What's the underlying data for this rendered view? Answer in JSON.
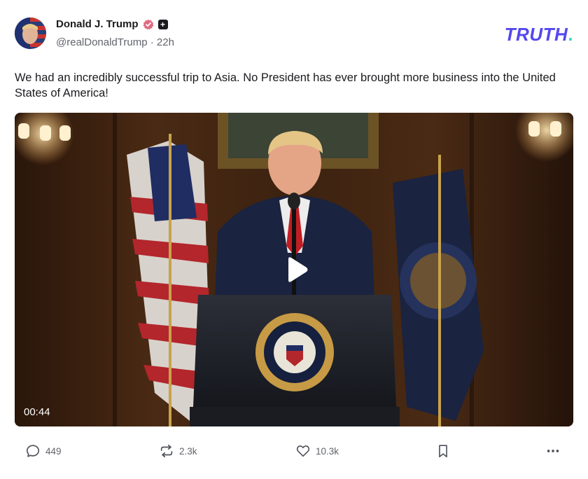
{
  "post": {
    "author_name": "Donald J. Trump",
    "handle_time": "@realDonaldTrump · 22h",
    "plus_badge": "+",
    "text": "We had an incredibly successful trip to Asia. No President has ever brought more business into the United States of America!"
  },
  "brand": {
    "logo_text": "TRUTH",
    "logo_dot": ".",
    "accent_color": "#5448ee",
    "dot_color": "#37d7c4"
  },
  "video": {
    "duration": "00:44",
    "seal_text": "SEAL OF THE PRESIDENT OF THE UNITED STATES"
  },
  "actions": {
    "replies": "449",
    "retruths": "2.3k",
    "likes": "10.3k"
  },
  "icons": {
    "verified": "verified-badge-icon",
    "reply": "speech-bubble-icon",
    "retruth": "repost-arrows-icon",
    "like": "heart-icon",
    "bookmark": "bookmark-icon",
    "more": "three-dots-icon",
    "play": "play-icon"
  }
}
